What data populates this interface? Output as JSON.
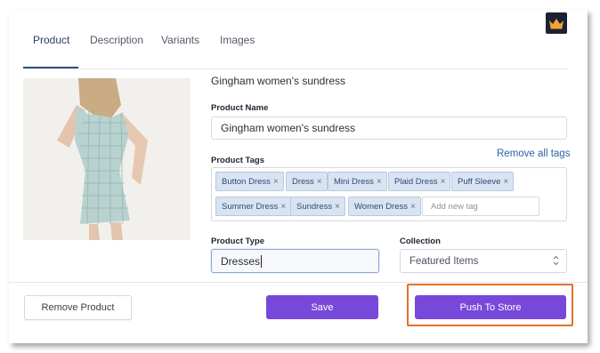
{
  "tabs": [
    {
      "label": "Product"
    },
    {
      "label": "Description"
    },
    {
      "label": "Variants"
    },
    {
      "label": "Images"
    }
  ],
  "product_heading": "Gingham women's sundress",
  "product_name": {
    "label": "Product Name",
    "value": "Gingham women's sundress"
  },
  "product_tags": {
    "label": "Product Tags",
    "remove_all_label": "Remove all tags",
    "tags": [
      "Button Dress",
      "Dress",
      "Mini Dress",
      "Plaid Dress",
      "Puff Sleeve",
      "Summer Dress",
      "Sundress",
      "Women Dress"
    ],
    "remove_glyph": "×",
    "add_placeholder": "Add new tag"
  },
  "product_type": {
    "label": "Product Type",
    "value": "Dresses"
  },
  "collection": {
    "label": "Collection",
    "value": "Featured Items"
  },
  "buttons": {
    "remove_product": "Remove Product",
    "save": "Save",
    "push_to_store": "Push To Store"
  },
  "colors": {
    "primary": "#7748d9",
    "tag_bg": "#d9e4f2",
    "link": "#2e63a8",
    "highlight": "#e0712c"
  },
  "icons": {
    "logo": "crown-icon",
    "select_arrows": "select-arrows-icon"
  }
}
